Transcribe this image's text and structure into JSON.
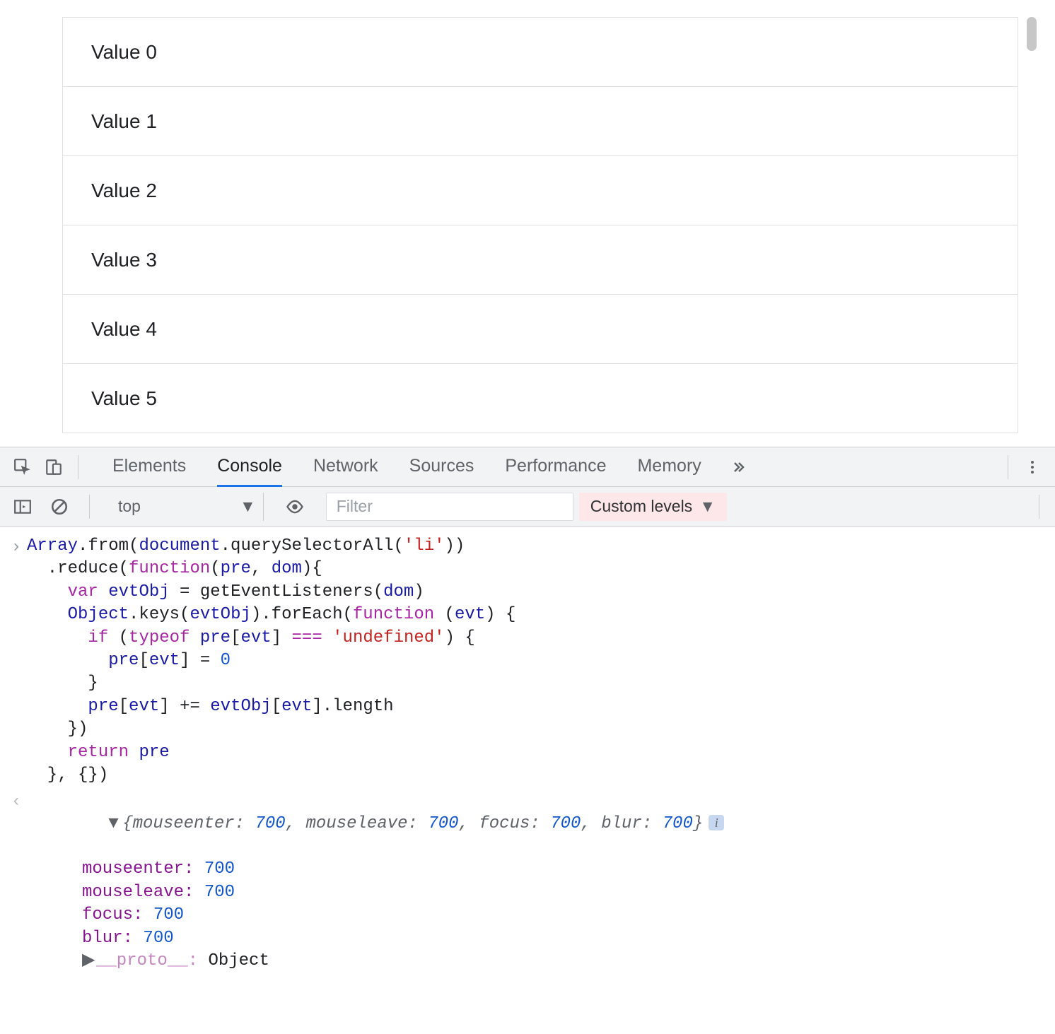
{
  "page": {
    "list_items": [
      "Value 0",
      "Value 1",
      "Value 2",
      "Value 3",
      "Value 4",
      "Value 5"
    ]
  },
  "devtools": {
    "tabs": [
      "Elements",
      "Console",
      "Network",
      "Sources",
      "Performance",
      "Memory"
    ],
    "active_tab": "Console",
    "context_label": "top",
    "filter_placeholder": "Filter",
    "levels_label": "Custom levels"
  },
  "console": {
    "input_lines": [
      [
        {
          "t": "Array",
          "c": "id"
        },
        {
          "t": ".from(",
          "c": ""
        },
        {
          "t": "document",
          "c": "id"
        },
        {
          "t": ".querySelectorAll(",
          "c": ""
        },
        {
          "t": "'li'",
          "c": "str"
        },
        {
          "t": "))",
          "c": ""
        }
      ],
      [
        {
          "t": "  .reduce(",
          "c": ""
        },
        {
          "t": "function",
          "c": "kw"
        },
        {
          "t": "(",
          "c": ""
        },
        {
          "t": "pre",
          "c": "id"
        },
        {
          "t": ", ",
          "c": ""
        },
        {
          "t": "dom",
          "c": "id"
        },
        {
          "t": "){",
          "c": ""
        }
      ],
      [
        {
          "t": "    ",
          "c": ""
        },
        {
          "t": "var",
          "c": "kw"
        },
        {
          "t": " ",
          "c": ""
        },
        {
          "t": "evtObj",
          "c": "id"
        },
        {
          "t": " = getEventListeners(",
          "c": ""
        },
        {
          "t": "dom",
          "c": "id"
        },
        {
          "t": ")",
          "c": ""
        }
      ],
      [
        {
          "t": "    ",
          "c": ""
        },
        {
          "t": "Object",
          "c": "id"
        },
        {
          "t": ".keys(",
          "c": ""
        },
        {
          "t": "evtObj",
          "c": "id"
        },
        {
          "t": ").forEach(",
          "c": ""
        },
        {
          "t": "function",
          "c": "kw"
        },
        {
          "t": " (",
          "c": ""
        },
        {
          "t": "evt",
          "c": "id"
        },
        {
          "t": ") {",
          "c": ""
        }
      ],
      [
        {
          "t": "      ",
          "c": ""
        },
        {
          "t": "if",
          "c": "kw"
        },
        {
          "t": " (",
          "c": ""
        },
        {
          "t": "typeof",
          "c": "kw"
        },
        {
          "t": " ",
          "c": ""
        },
        {
          "t": "pre",
          "c": "id"
        },
        {
          "t": "[",
          "c": ""
        },
        {
          "t": "evt",
          "c": "id"
        },
        {
          "t": "] ",
          "c": ""
        },
        {
          "t": "===",
          "c": "op"
        },
        {
          "t": " ",
          "c": ""
        },
        {
          "t": "'undefined'",
          "c": "str"
        },
        {
          "t": ") {",
          "c": ""
        }
      ],
      [
        {
          "t": "        ",
          "c": ""
        },
        {
          "t": "pre",
          "c": "id"
        },
        {
          "t": "[",
          "c": ""
        },
        {
          "t": "evt",
          "c": "id"
        },
        {
          "t": "] = ",
          "c": ""
        },
        {
          "t": "0",
          "c": "num"
        }
      ],
      [
        {
          "t": "      }",
          "c": ""
        }
      ],
      [
        {
          "t": "      ",
          "c": ""
        },
        {
          "t": "pre",
          "c": "id"
        },
        {
          "t": "[",
          "c": ""
        },
        {
          "t": "evt",
          "c": "id"
        },
        {
          "t": "] += ",
          "c": ""
        },
        {
          "t": "evtObj",
          "c": "id"
        },
        {
          "t": "[",
          "c": ""
        },
        {
          "t": "evt",
          "c": "id"
        },
        {
          "t": "].length",
          "c": ""
        }
      ],
      [
        {
          "t": "    })",
          "c": ""
        }
      ],
      [
        {
          "t": "    ",
          "c": ""
        },
        {
          "t": "return",
          "c": "kw"
        },
        {
          "t": " ",
          "c": ""
        },
        {
          "t": "pre",
          "c": "id"
        }
      ],
      [
        {
          "t": "  }, {})",
          "c": ""
        }
      ]
    ],
    "result_summary": [
      {
        "k": "mouseenter",
        "v": "700"
      },
      {
        "k": "mouseleave",
        "v": "700"
      },
      {
        "k": "focus",
        "v": "700"
      },
      {
        "k": "blur",
        "v": "700"
      }
    ],
    "result_props": [
      {
        "k": "mouseenter",
        "v": "700"
      },
      {
        "k": "mouseleave",
        "v": "700"
      },
      {
        "k": "focus",
        "v": "700"
      },
      {
        "k": "blur",
        "v": "700"
      }
    ],
    "proto_key": "__proto__",
    "proto_val": "Object"
  }
}
